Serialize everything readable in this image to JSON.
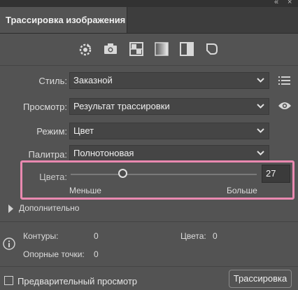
{
  "panel": {
    "tab_title": "Трассировка изображения",
    "window_controls": {
      "collapse_glyph": "«",
      "close_glyph": "×"
    }
  },
  "presets": {
    "items": [
      {
        "name": "auto-color-icon"
      },
      {
        "name": "high-fidelity-photo-icon"
      },
      {
        "name": "low-fidelity-photo-icon"
      },
      {
        "name": "grayscale-icon"
      },
      {
        "name": "black-and-white-icon"
      },
      {
        "name": "outline-icon"
      }
    ]
  },
  "settings": {
    "style": {
      "label": "Стиль:",
      "value": "Заказной"
    },
    "view": {
      "label": "Просмотр:",
      "value": "Результат трассировки"
    },
    "mode": {
      "label": "Режим:",
      "value": "Цвет"
    },
    "palette": {
      "label": "Палитра:",
      "value": "Полнотоновая"
    }
  },
  "colors_slider": {
    "label": "Цвета:",
    "value": "27",
    "fraction": 0.28,
    "min_label": "Меньше",
    "max_label": "Больше"
  },
  "advanced": {
    "label": "Дополнительно"
  },
  "stats": {
    "paths_label": "Контуры:",
    "paths_value": "0",
    "colors_label": "Цвета:",
    "colors_value": "0",
    "anchors_label": "Опорные точки:",
    "anchors_value": "0"
  },
  "footer": {
    "preview_label": "Предварительный просмотр",
    "trace_button": "Трассировка"
  },
  "colors": {
    "highlight": "#e989b0",
    "panel_bg": "#535353"
  }
}
